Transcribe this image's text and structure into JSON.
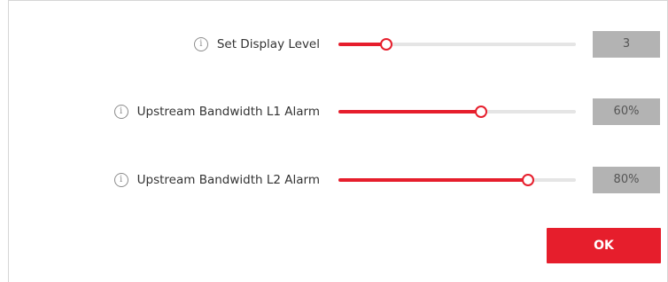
{
  "settings": [
    {
      "label": "Set Display Level",
      "value_text": "3",
      "level": 0.2
    },
    {
      "label": "Upstream Bandwidth L1 Alarm",
      "value_text": "60%",
      "level": 0.6
    },
    {
      "label": "Upstream Bandwidth L2 Alarm",
      "value_text": "80%",
      "level": 0.8
    }
  ],
  "ok_label": "OK",
  "icons": {
    "info": "info-circle-icon",
    "info_glyph": "i"
  },
  "colors": {
    "accent": "#e61e2c",
    "track": "#e5e5e5",
    "value_box": "#b3b3b3",
    "value_text": "#555555",
    "label_text": "#333333"
  }
}
